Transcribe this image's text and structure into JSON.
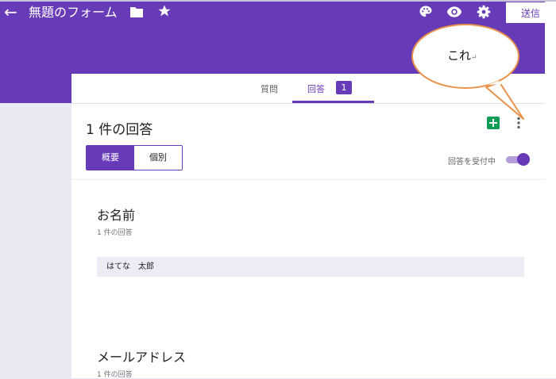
{
  "header": {
    "back_icon": "arrow-back-icon",
    "form_title": "無題のフォーム",
    "folder_icon": "folder-icon",
    "star_icon": "star-icon",
    "palette_icon": "palette-icon",
    "preview_icon": "eye-icon",
    "settings_icon": "gear-icon",
    "send_label": "送信"
  },
  "tabs": {
    "questions": "質問",
    "responses": "回答",
    "response_count": "1"
  },
  "summary": {
    "title": "1 件の回答",
    "sheets_icon": "sheets-icon",
    "more_icon": "more-vert-icon",
    "view_summary": "概要",
    "view_individual": "個別",
    "accepting_label": "回答を受付中",
    "accepting": true
  },
  "questions": [
    {
      "title": "お名前",
      "count": "1 件の回答",
      "answer": "はてな　太郎"
    },
    {
      "title": "メールアドレス",
      "count": "1 件の回答"
    }
  ],
  "callout": {
    "text": "これ",
    "return_mark": "↵"
  },
  "colors": {
    "brand": "#673ab7",
    "background": "#eae8f2",
    "callout_border": "#e8924a"
  }
}
